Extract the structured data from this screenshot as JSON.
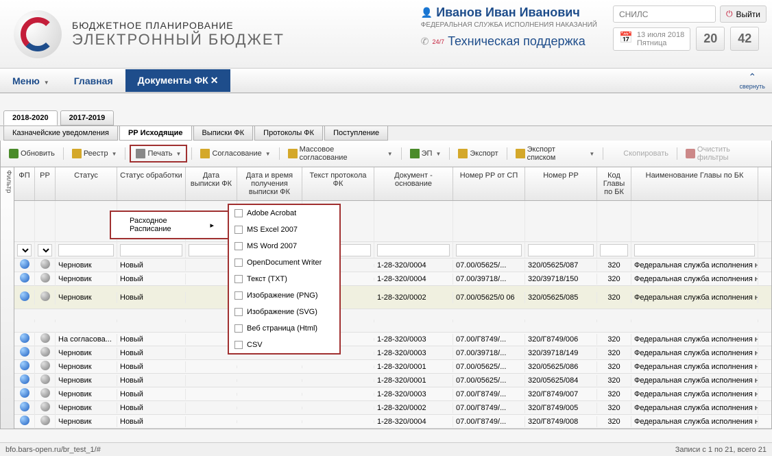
{
  "header": {
    "title1": "БЮДЖЕТНОЕ ПЛАНИРОВАНИЕ",
    "title2": "ЭЛЕКТРОННЫЙ БЮДЖЕТ",
    "user_name": "Иванов Иван Иванович",
    "user_dept": "ФЕДЕРАЛЬНАЯ СЛУЖБА ИСПОЛНЕНИЯ НАКАЗАНИЙ",
    "support_247": "24/7",
    "support_text": "Техническая поддержка",
    "snils_placeholder": "СНИЛС",
    "exit_label": "Выйти",
    "date": "13 июля 2018",
    "day": "Пятница",
    "hours": "20",
    "minutes": "42"
  },
  "nav": {
    "menu": "Меню",
    "home": "Главная",
    "docs": "Документы ФК",
    "collapse": "свернуть"
  },
  "year_tabs": [
    "2018-2020",
    "2017-2019"
  ],
  "sub_tabs": [
    "Казначейские уведомления",
    "РР Исходящие",
    "Выписки ФК",
    "Протоколы ФК",
    "Поступление"
  ],
  "toolbar": {
    "refresh": "Обновить",
    "registry": "Реестр",
    "print": "Печать",
    "approval": "Согласование",
    "mass_approval": "Массовое согласование",
    "ep": "ЭП",
    "export": "Экспорт",
    "export_list": "Экспорт списком",
    "copy": "Скопировать",
    "clear_filters": "Очистить фильтры"
  },
  "grid": {
    "filter_label": "Фильтр",
    "columns": [
      "ФП",
      "РР",
      "Статус",
      "Статус обработки",
      "Дата выписки ФК",
      "Дата и время получения выписки ФК",
      "Текст протокола ФК",
      "Документ - основание",
      "Номер РР от СП",
      "Номер РР",
      "Код Главы по БК",
      "Наименование Главы по БК"
    ],
    "rows": [
      {
        "status": "Черновик",
        "proc": "Новый",
        "doc": "1-28-320/0004",
        "nrsp": "07.00/05625/...",
        "nrr": "320/05625/087",
        "code": "320",
        "name": "Федеральная служба исполнения нак"
      },
      {
        "status": "Черновик",
        "proc": "Новый",
        "doc": "1-28-320/0004",
        "nrsp": "07.00/39718/...",
        "nrr": "320/39718/150",
        "code": "320",
        "name": "Федеральная служба исполнения нак"
      },
      {
        "status": "Черновик",
        "proc": "Новый",
        "doc": "1-28-320/0002",
        "nrsp": "07.00/05625/0 06",
        "nrr": "320/05625/085",
        "code": "320",
        "name": "Федеральная служба исполнения нак"
      },
      {
        "status": "На согласова...",
        "proc": "Новый",
        "doc": "1-28-320/0003",
        "nrsp": "07.00/Г8749/...",
        "nrr": "320/Г8749/006",
        "code": "320",
        "name": "Федеральная служба исполнения нак"
      },
      {
        "status": "Черновик",
        "proc": "Новый",
        "doc": "1-28-320/0003",
        "nrsp": "07.00/39718/...",
        "nrr": "320/39718/149",
        "code": "320",
        "name": "Федеральная служба исполнения нак"
      },
      {
        "status": "Черновик",
        "proc": "Новый",
        "doc": "1-28-320/0001",
        "nrsp": "07.00/05625/...",
        "nrr": "320/05625/086",
        "code": "320",
        "name": "Федеральная служба исполнения нак"
      },
      {
        "status": "Черновик",
        "proc": "Новый",
        "doc": "1-28-320/0001",
        "nrsp": "07.00/05625/...",
        "nrr": "320/05625/084",
        "code": "320",
        "name": "Федеральная служба исполнения нак"
      },
      {
        "status": "Черновик",
        "proc": "Новый",
        "doc": "1-28-320/0003",
        "nrsp": "07.00/Г8749/...",
        "nrr": "320/Г8749/007",
        "code": "320",
        "name": "Федеральная служба исполнения нак"
      },
      {
        "status": "Черновик",
        "proc": "Новый",
        "doc": "1-28-320/0002",
        "nrsp": "07.00/Г8749/...",
        "nrr": "320/Г8749/005",
        "code": "320",
        "name": "Федеральная служба исполнения нак"
      },
      {
        "status": "Черновик",
        "proc": "Новый",
        "doc": "1-28-320/0004",
        "nrsp": "07.00/Г8749/...",
        "nrr": "320/Г8749/008",
        "code": "320",
        "name": "Федеральная служба исполнения нак"
      }
    ]
  },
  "popup": {
    "item": "Расходное Расписание"
  },
  "export_menu": [
    "Adobe Acrobat",
    "MS Excel 2007",
    "MS Word 2007",
    "OpenDocument Writer",
    "Текст (TXT)",
    "Изображение (PNG)",
    "Изображение (SVG)",
    "Веб страница (Html)",
    "CSV"
  ],
  "footer": {
    "url": "bfo.bars-open.ru/br_test_1/#",
    "records": "Записи с 1 по 21, всего 21"
  }
}
